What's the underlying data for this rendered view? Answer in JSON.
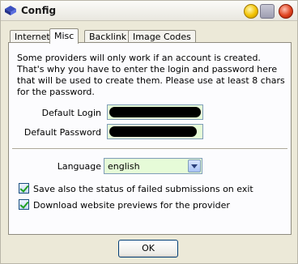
{
  "window": {
    "title": "Config"
  },
  "tabs": [
    "Internet",
    "Misc",
    "Backlink",
    "Image Codes"
  ],
  "active_tab": "Misc",
  "misc": {
    "intro": "Some providers will only work if an account is created. That's why you have to enter the login and password here that will be used to create them. Please use at least 8 chars for the password.",
    "login_label": "Default Login",
    "password_label": "Default Password",
    "language_label": "Language",
    "language_value": "english",
    "checkbox1_label": "Save also the status of failed submissions on exit",
    "checkbox1_checked": true,
    "checkbox2_label": "Download website previews for the provider",
    "checkbox2_checked": true
  },
  "buttons": {
    "ok": "OK"
  },
  "colors": {
    "field_bg": "#e6fbd8",
    "panel_bg": "#fcfcfe",
    "window_bg": "#ece9d8"
  }
}
